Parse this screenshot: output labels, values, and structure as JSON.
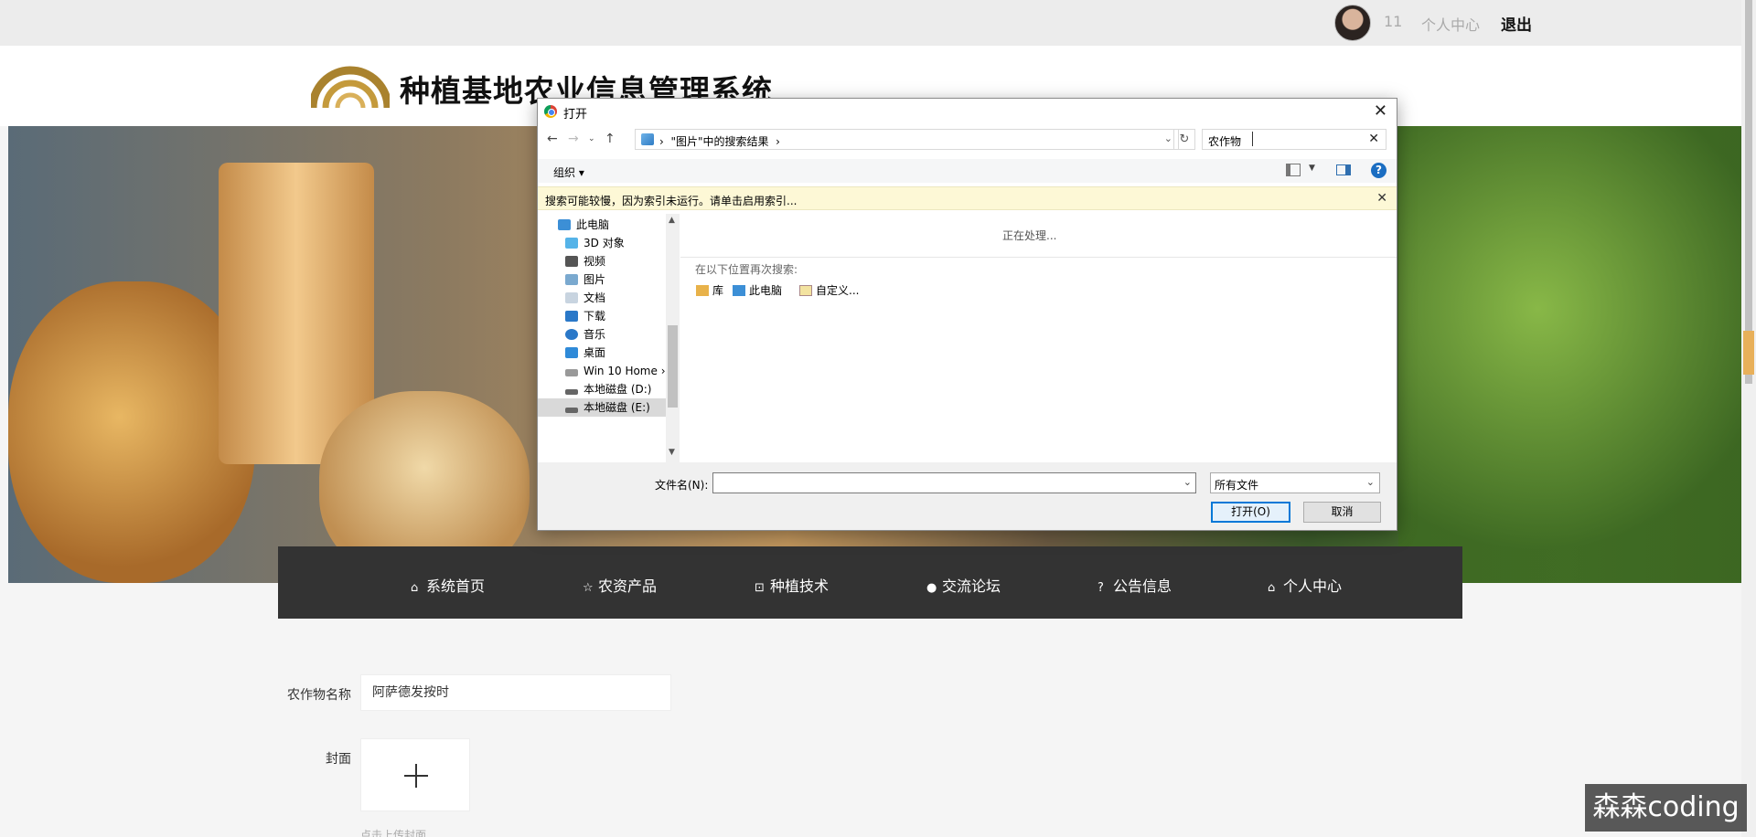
{
  "topbar": {
    "user_count": "11",
    "personal_center": "个人中心",
    "logout": "退出"
  },
  "header": {
    "site_title": "种植基地农业信息管理系统"
  },
  "nav": {
    "items": [
      {
        "icon": "home-icon",
        "label": "系统首页"
      },
      {
        "icon": "star-icon",
        "label": "农资产品"
      },
      {
        "icon": "bag-icon",
        "label": "种植技术"
      },
      {
        "icon": "alert-icon",
        "label": "交流论坛"
      },
      {
        "icon": "question-icon",
        "label": "公告信息"
      },
      {
        "icon": "home-icon",
        "label": "个人中心"
      }
    ]
  },
  "form": {
    "crop_name_label": "农作物名称",
    "crop_name_value": "阿萨德发按时",
    "cover_label": "封面",
    "upload_hint": "点击上传封面"
  },
  "watermark": "森森coding",
  "dialog": {
    "title": "打开",
    "address": "\"图片\"中的搜索结果",
    "search_value": "农作物",
    "organize": "组织 ▾",
    "info_text": "搜索可能较慢，因为索引未运行。请单击启用索引...",
    "tree": [
      {
        "label": "此电脑",
        "icon": "computer-icon"
      },
      {
        "label": "3D 对象",
        "icon": "3d-objects-icon"
      },
      {
        "label": "视频",
        "icon": "video-icon"
      },
      {
        "label": "图片",
        "icon": "pictures-icon"
      },
      {
        "label": "文档",
        "icon": "documents-icon"
      },
      {
        "label": "下载",
        "icon": "download-icon"
      },
      {
        "label": "音乐",
        "icon": "music-icon"
      },
      {
        "label": "桌面",
        "icon": "desktop-icon"
      },
      {
        "label": "Win 10 Home ›",
        "icon": "drive-icon"
      },
      {
        "label": "本地磁盘 (D:)",
        "icon": "drive-icon"
      },
      {
        "label": "本地磁盘 (E:)",
        "icon": "drive-icon",
        "selected": true
      }
    ],
    "processing": "正在处理...",
    "search_again": "在以下位置再次搜索:",
    "locations": [
      {
        "label": "库",
        "icon": "library-icon"
      },
      {
        "label": "此电脑",
        "icon": "computer-icon"
      },
      {
        "label": "自定义...",
        "icon": "custom-icon"
      }
    ],
    "filename_label": "文件名(N):",
    "filename_value": "",
    "filetype": "所有文件",
    "open_button": "打开(O)",
    "cancel_button": "取消"
  }
}
